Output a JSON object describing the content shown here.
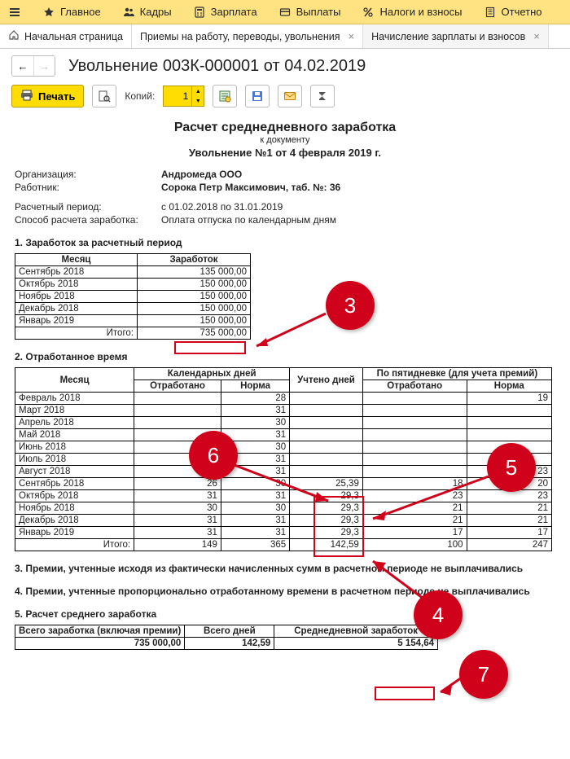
{
  "menu": {
    "main": "Главное",
    "staff": "Кадры",
    "salary": "Зарплата",
    "payments": "Выплаты",
    "taxes": "Налоги и взносы",
    "reports": "Отчетно"
  },
  "tabs": {
    "home": "Начальная страница",
    "hires": "Приемы на работу, переводы, увольнения",
    "payroll": "Начисление зарплаты и взносов"
  },
  "doc_title": "Увольнение 003К-000001 от 04.02.2019",
  "toolbar": {
    "print": "Печать",
    "copies_label": "Копий:",
    "copies_value": "1"
  },
  "report": {
    "title": "Расчет среднедневного заработка",
    "subtitle": "к документу",
    "sub2": "Увольнение №1 от 4 февраля 2019 г.",
    "org_lbl": "Организация:",
    "org_val": "Андромеда ООО",
    "emp_lbl": "Работник:",
    "emp_val": "Сорока Петр Максимович, таб. №: 36",
    "period_lbl": "Расчетный период:",
    "period_val": "с 01.02.2018 по 31.01.2019",
    "method_lbl": "Способ расчета заработка:",
    "method_val": "Оплата отпуска по календарным дням",
    "sec1": "1. Заработок за расчетный период",
    "t1": {
      "h_month": "Месяц",
      "h_earn": "Заработок",
      "rows": [
        {
          "m": "Сентябрь 2018",
          "v": "135 000,00"
        },
        {
          "m": "Октябрь 2018",
          "v": "150 000,00"
        },
        {
          "m": "Ноябрь 2018",
          "v": "150 000,00"
        },
        {
          "m": "Декабрь 2018",
          "v": "150 000,00"
        },
        {
          "m": "Январь 2019",
          "v": "150 000,00"
        }
      ],
      "total_lbl": "Итого:",
      "total_val": "735 000,00"
    },
    "sec2": "2. Отработанное время",
    "t2": {
      "h_month": "Месяц",
      "h_cal": "Календарных дней",
      "h_uch": "Учтено дней",
      "h_five": "По пятидневке (для учета премий)",
      "h_worked": "Отработано",
      "h_norm": "Норма",
      "rows": [
        {
          "m": "Февраль 2018",
          "co": "",
          "cn": "28",
          "u": "",
          "fo": "",
          "fn": "19"
        },
        {
          "m": "Март 2018",
          "co": "",
          "cn": "31",
          "u": "",
          "fo": "",
          "fn": ""
        },
        {
          "m": "Апрель 2018",
          "co": "",
          "cn": "30",
          "u": "",
          "fo": "",
          "fn": ""
        },
        {
          "m": "Май 2018",
          "co": "",
          "cn": "31",
          "u": "",
          "fo": "",
          "fn": ""
        },
        {
          "m": "Июнь 2018",
          "co": "",
          "cn": "30",
          "u": "",
          "fo": "",
          "fn": ""
        },
        {
          "m": "Июль 2018",
          "co": "",
          "cn": "31",
          "u": "",
          "fo": "",
          "fn": ""
        },
        {
          "m": "Август 2018",
          "co": "",
          "cn": "31",
          "u": "",
          "fo": "",
          "fn": "23"
        },
        {
          "m": "Сентябрь 2018",
          "co": "26",
          "cn": "30",
          "u": "25,39",
          "fo": "18",
          "fn": "20"
        },
        {
          "m": "Октябрь 2018",
          "co": "31",
          "cn": "31",
          "u": "29,3",
          "fo": "23",
          "fn": "23"
        },
        {
          "m": "Ноябрь 2018",
          "co": "30",
          "cn": "30",
          "u": "29,3",
          "fo": "21",
          "fn": "21"
        },
        {
          "m": "Декабрь 2018",
          "co": "31",
          "cn": "31",
          "u": "29,3",
          "fo": "21",
          "fn": "21"
        },
        {
          "m": "Январь 2019",
          "co": "31",
          "cn": "31",
          "u": "29,3",
          "fo": "17",
          "fn": "17"
        }
      ],
      "total_lbl": "Итого:",
      "tot_co": "149",
      "tot_cn": "365",
      "tot_u": "142,59",
      "tot_fo": "100",
      "tot_fn": "247"
    },
    "sec3": "3. Премии, учтенные исходя из фактически начисленных сумм в расчетном периоде не выплачивались",
    "sec4": "4. Премии, учтенные пропорционально отработанному времени в расчетном периоде не выплачивались",
    "sec5": "5. Расчет среднего  заработка",
    "t5": {
      "h_total_earn": "Всего заработка (включая премии)",
      "h_total_days": "Всего дней",
      "h_avg": "Среднедневной заработок",
      "v_total_earn": "735 000,00",
      "v_total_days": "142,59",
      "v_avg": "5 154,64"
    }
  },
  "callouts": {
    "c3": "3",
    "c4": "4",
    "c5": "5",
    "c6": "6",
    "c7": "7"
  }
}
